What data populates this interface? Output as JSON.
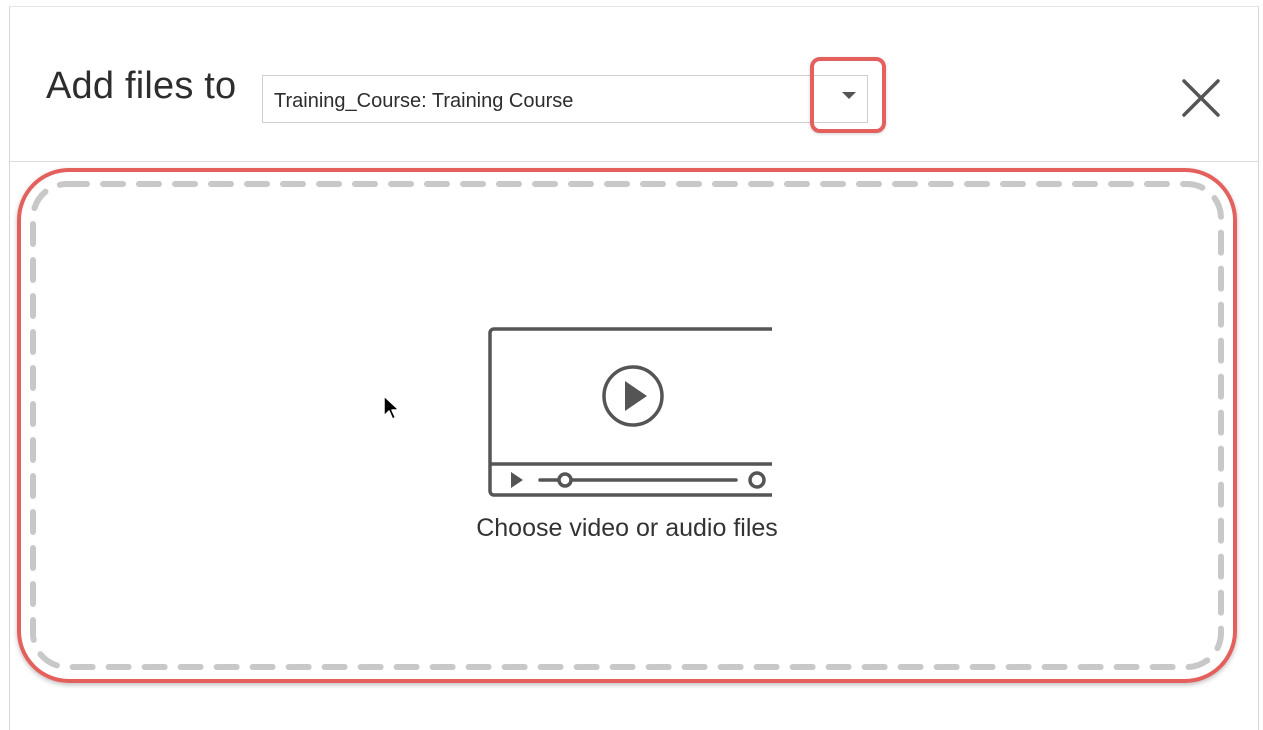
{
  "dialog": {
    "title": "Add files to",
    "destination_select": {
      "selected_value": "Training_Course: Training Course"
    },
    "close_icon": "close-icon"
  },
  "dropzone": {
    "label": "Choose video or audio files",
    "icon": "video-player-icon"
  },
  "colors": {
    "highlight": "#e4605c",
    "dash": "#c8c8c8",
    "icon": "#555555"
  }
}
